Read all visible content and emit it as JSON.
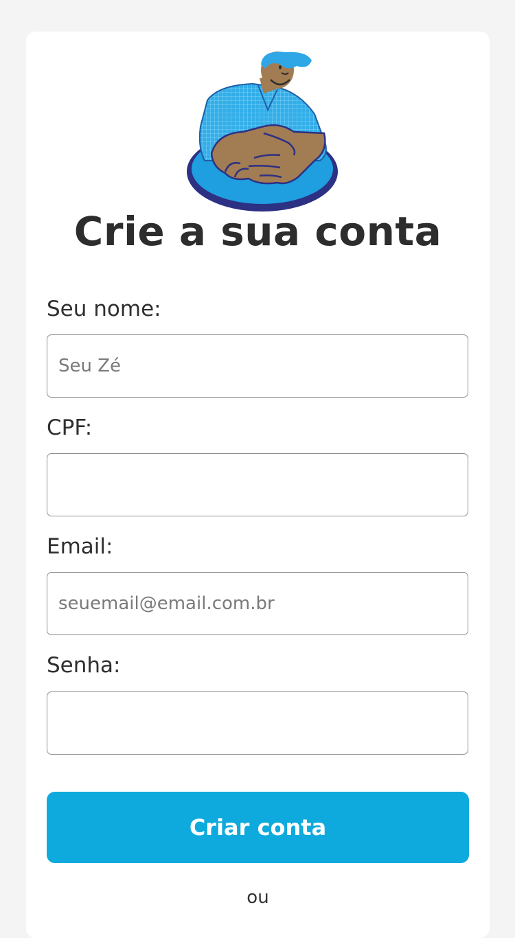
{
  "form": {
    "title": "Crie a sua conta",
    "illustration_icon": "handshake-illustration",
    "fields": [
      {
        "label": "Seu nome:",
        "value": "",
        "placeholder": "Seu Zé"
      },
      {
        "label": "CPF:",
        "value": "",
        "placeholder": ""
      },
      {
        "label": "Email:",
        "value": "",
        "placeholder": "seuemail@email.com.br"
      },
      {
        "label": "Senha:",
        "value": "",
        "placeholder": ""
      }
    ],
    "submit_label": "Criar conta",
    "or_label": "ou"
  },
  "colors": {
    "background": "#f4f4f4",
    "card": "#ffffff",
    "accent": "#0eaadd",
    "text": "#2d2d2d",
    "input_border": "#8d8d8d"
  }
}
